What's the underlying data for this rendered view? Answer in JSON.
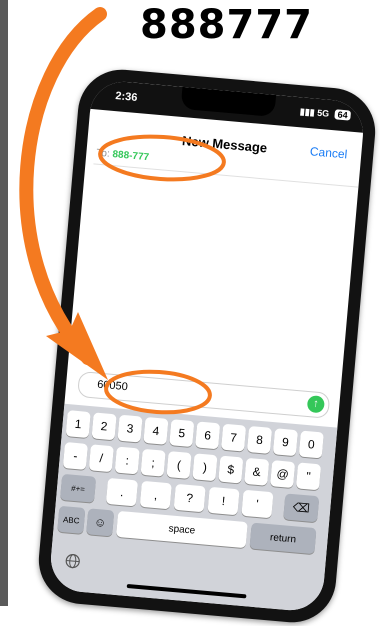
{
  "headline": "888777",
  "status_bar": {
    "time": "2:36",
    "network": "5G",
    "battery": "64"
  },
  "nav": {
    "title": "New Message",
    "cancel": "Cancel"
  },
  "recipient": {
    "label": "To:",
    "value": "888-777"
  },
  "compose": {
    "text": "60050"
  },
  "keyboard": {
    "row1": [
      "1",
      "2",
      "3",
      "4",
      "5",
      "6",
      "7",
      "8",
      "9",
      "0"
    ],
    "row2": [
      "-",
      "/",
      ":",
      ";",
      "(",
      ")",
      "$",
      "&",
      "@",
      "\""
    ],
    "row3": [
      ".",
      ",",
      "?",
      "!",
      "'"
    ],
    "row3_left": "#+=",
    "row3_right_icon": "delete-icon",
    "row4": {
      "abc": "ABC",
      "emoji_icon": "emoji-icon",
      "space": "space",
      "return": "return"
    },
    "globe_icon": "globe-icon"
  },
  "colors": {
    "accent": "#f47a20",
    "link": "#1a7cf5",
    "green": "#34c759"
  }
}
